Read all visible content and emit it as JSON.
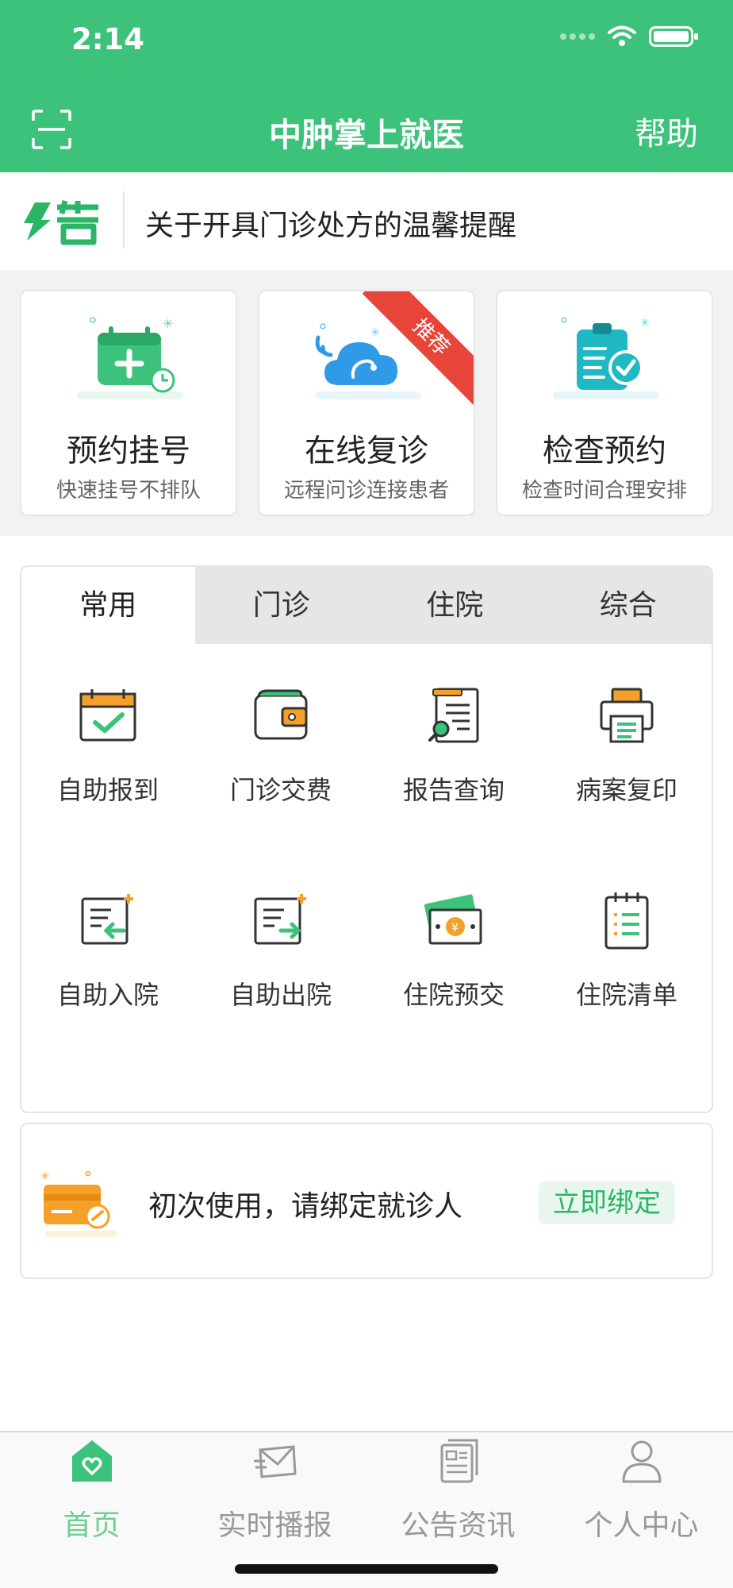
{
  "status_bar": {
    "time": "2:14"
  },
  "header": {
    "title": "中肿掌上就医",
    "help_label": "帮助",
    "scan_icon": "scan-icon"
  },
  "notice": {
    "logo_text": "公告",
    "text": "关于开具门诊处方的温馨提醒"
  },
  "feature_cards": [
    {
      "title": "预约挂号",
      "subtitle": "快速挂号不排队",
      "icon": "calendar-plus-icon"
    },
    {
      "title": "在线复诊",
      "subtitle": "远程问诊连接患者",
      "icon": "cloud-stethoscope-icon",
      "badge": "推荐"
    },
    {
      "title": "检查预约",
      "subtitle": "检查时间合理安排",
      "icon": "clipboard-check-icon"
    }
  ],
  "tabs": [
    {
      "label": "常用",
      "active": true
    },
    {
      "label": "门诊",
      "active": false
    },
    {
      "label": "住院",
      "active": false
    },
    {
      "label": "综合",
      "active": false
    }
  ],
  "services": [
    {
      "label": "自助报到",
      "icon": "calendar-check-icon"
    },
    {
      "label": "门诊交费",
      "icon": "wallet-icon"
    },
    {
      "label": "报告查询",
      "icon": "report-search-icon"
    },
    {
      "label": "病案复印",
      "icon": "printer-icon"
    },
    {
      "label": "自助入院",
      "icon": "admission-icon"
    },
    {
      "label": "自助出院",
      "icon": "discharge-icon"
    },
    {
      "label": "住院预交",
      "icon": "money-icon"
    },
    {
      "label": "住院清单",
      "icon": "checklist-icon"
    }
  ],
  "bind_card": {
    "text": "初次使用，请绑定就诊人",
    "button_label": "立即绑定"
  },
  "bottom_nav": [
    {
      "label": "首页",
      "icon": "home-icon",
      "active": true
    },
    {
      "label": "实时播报",
      "icon": "mail-icon",
      "active": false
    },
    {
      "label": "公告资讯",
      "icon": "news-icon",
      "active": false
    },
    {
      "label": "个人中心",
      "icon": "person-icon",
      "active": false
    }
  ],
  "colors": {
    "primary": "#3cc27a",
    "ribbon": "#e8443a",
    "accent_orange": "#f5a02a",
    "inactive": "#999999"
  }
}
